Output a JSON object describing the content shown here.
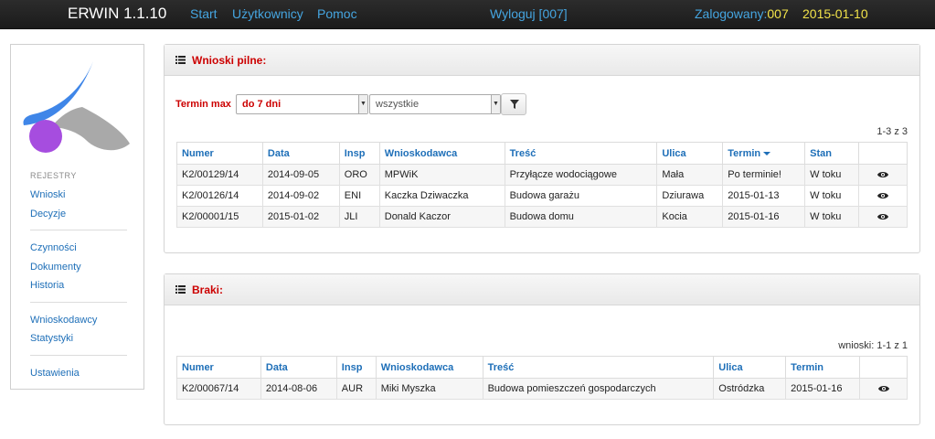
{
  "topbar": {
    "brand": "ERWIN 1.1.10",
    "nav": [
      "Start",
      "Użytkownicy",
      "Pomoc"
    ],
    "logout": "Wyloguj [007]",
    "logged_label": "Zalogowany:",
    "logged_id": "007",
    "date": "2015-01-10"
  },
  "sidebar": {
    "section": "REJESTRY",
    "groups": [
      [
        "Wnioski",
        "Decyzje"
      ],
      [
        "Czynności",
        "Dokumenty",
        "Historia"
      ],
      [
        "Wnioskodawcy",
        "Statystyki"
      ],
      [
        "Ustawienia"
      ]
    ]
  },
  "urgent": {
    "title": "Wnioski pilne:",
    "filter_label": "Termin max",
    "filter_value": "do 7 dni",
    "filter2_value": "wszystkie",
    "counter": "1-3 z 3",
    "headers": [
      "Numer",
      "Data",
      "Insp",
      "Wnioskodawca",
      "Treść",
      "Ulica",
      "Termin",
      "Stan"
    ],
    "rows": [
      [
        "K2/00129/14",
        "2014-09-05",
        "ORO",
        "MPWiK",
        "Przyłącze wodociągowe",
        "Mała",
        "Po terminie!",
        "W toku"
      ],
      [
        "K2/00126/14",
        "2014-09-02",
        "ENI",
        "Kaczka Dziwaczka",
        "Budowa garażu",
        "Dziurawa",
        "2015-01-13",
        "W toku"
      ],
      [
        "K2/00001/15",
        "2015-01-02",
        "JLI",
        "Donald Kaczor",
        "Budowa domu",
        "Kocia",
        "2015-01-16",
        "W toku"
      ]
    ]
  },
  "missing": {
    "title": "Braki:",
    "counter": "wnioski: 1-1 z 1",
    "headers": [
      "Numer",
      "Data",
      "Insp",
      "Wnioskodawca",
      "Treść",
      "Ulica",
      "Termin"
    ],
    "rows": [
      [
        "K2/00067/14",
        "2014-08-06",
        "AUR",
        "Miki Myszka",
        "Budowa pomieszczeń gospodarczych",
        "Ostródzka",
        "2015-01-16"
      ]
    ]
  },
  "colors": {
    "accent": "#1e6fb8",
    "alert": "#cc0000",
    "nav": "#45a5e0",
    "highlight": "#f2e34a"
  }
}
